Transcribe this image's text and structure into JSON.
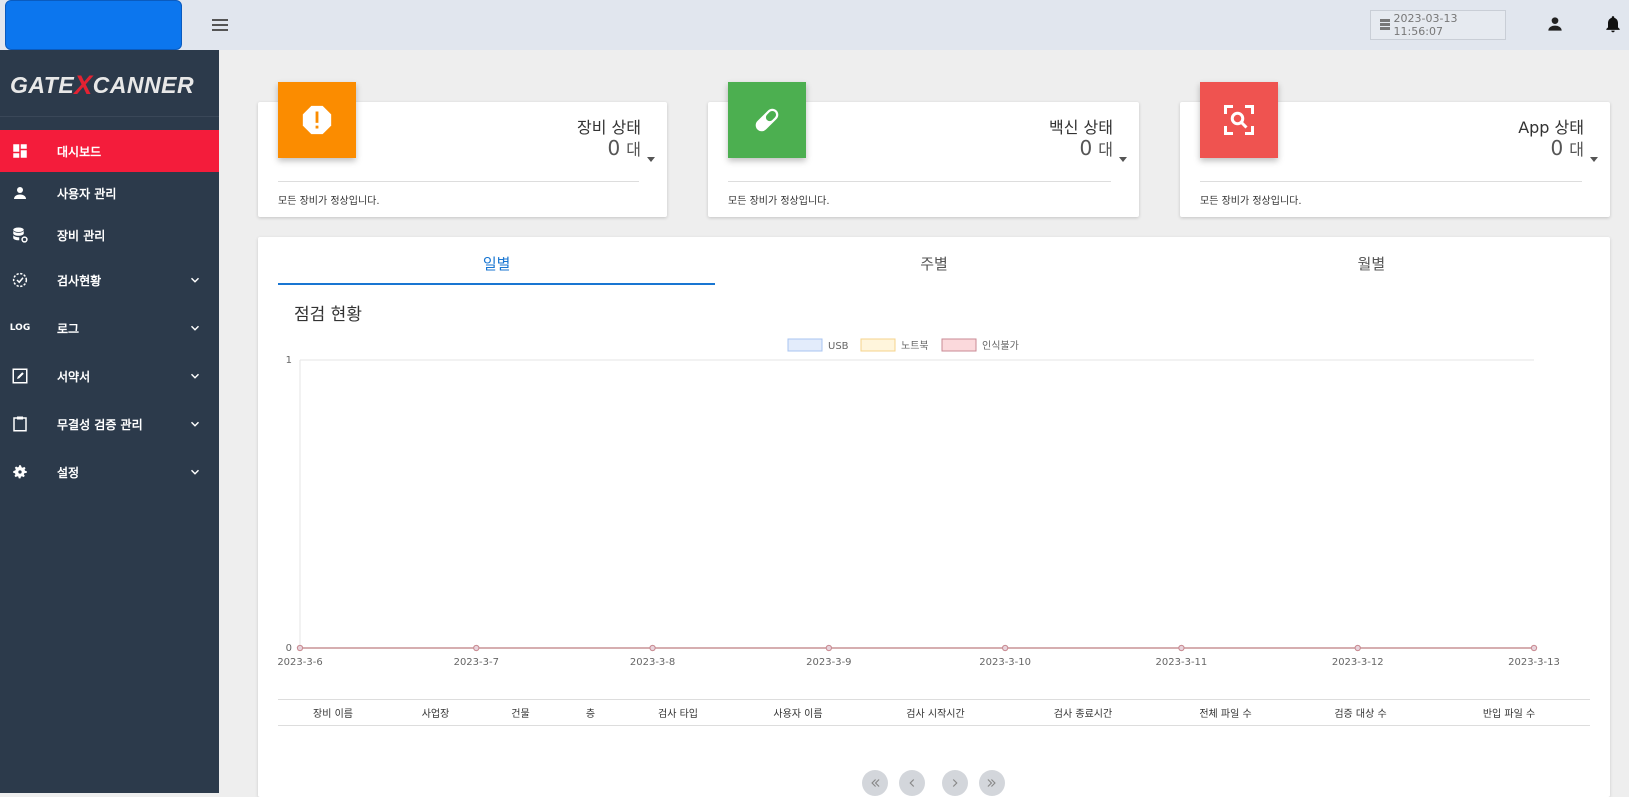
{
  "header": {
    "clock": "2023-03-13 11:56:07",
    "icons": [
      "menu-icon",
      "server-icon",
      "user-icon",
      "bell-icon"
    ]
  },
  "sidebar": {
    "logo_left": "GATE",
    "logo_x": "X",
    "logo_right": "CANNER",
    "items": [
      {
        "label": "대시보드",
        "icon": "dashboard-icon",
        "active": true
      },
      {
        "label": "사용자 관리",
        "icon": "person-icon"
      },
      {
        "label": "장비 관리",
        "icon": "device-settings-icon"
      },
      {
        "label": "검사현황",
        "icon": "check-circle-icon",
        "expandable": true
      },
      {
        "label": "로그",
        "icon": "log-icon",
        "icon_text": "LOG",
        "expandable": true
      },
      {
        "label": "서약서",
        "icon": "edit-icon",
        "expandable": true
      },
      {
        "label": "무결성 검증 관리",
        "icon": "clipboard-icon",
        "expandable": true
      },
      {
        "label": "설정",
        "icon": "gear-icon",
        "expandable": true
      }
    ]
  },
  "cards": [
    {
      "title": "장비 상태",
      "value": "0",
      "unit": "대",
      "footer": "모든 장비가 정상입니다.",
      "color": "#fb8c00",
      "icon": "alert-octagon-icon"
    },
    {
      "title": "백신 상태",
      "value": "0",
      "unit": "대",
      "footer": "모든 장비가 정상입니다.",
      "color": "#4caf50",
      "icon": "pill-icon"
    },
    {
      "title": "App 상태",
      "value": "0",
      "unit": "대",
      "footer": "모든 장비가 정상입니다.",
      "color": "#ef5350",
      "icon": "scan-search-icon"
    }
  ],
  "tabs": [
    "일별",
    "주별",
    "월별"
  ],
  "section_title": "점검 현황",
  "chart_data": {
    "type": "line",
    "categories": [
      "2023-3-6",
      "2023-3-7",
      "2023-3-8",
      "2023-3-9",
      "2023-3-10",
      "2023-3-11",
      "2023-3-12",
      "2023-3-13"
    ],
    "series": [
      {
        "name": "USB",
        "values": [
          0,
          0,
          0,
          0,
          0,
          0,
          0,
          0
        ],
        "fill": "#e3ecfb",
        "stroke": "#a8c4f0"
      },
      {
        "name": "노트북",
        "values": [
          0,
          0,
          0,
          0,
          0,
          0,
          0,
          0
        ],
        "fill": "#fff5dc",
        "stroke": "#f5d38c"
      },
      {
        "name": "인식불가",
        "values": [
          0,
          0,
          0,
          0,
          0,
          0,
          0,
          0
        ],
        "fill": "#fbd9dc",
        "stroke": "#c98a95"
      }
    ],
    "ylim": [
      0,
      1
    ],
    "yticks": [
      "0",
      "1"
    ],
    "legend": "top-center",
    "grid": true
  },
  "table": {
    "columns": [
      "장비 이름",
      "사업장",
      "건물",
      "층",
      "검사 타입",
      "사용자 이름",
      "검사 시작시간",
      "검사 종료시간",
      "전체 파일 수",
      "검증 대상 수",
      "반입 파일 수"
    ]
  },
  "pager": [
    "first-page-icon",
    "prev-page-icon",
    "next-page-icon",
    "last-page-icon"
  ]
}
